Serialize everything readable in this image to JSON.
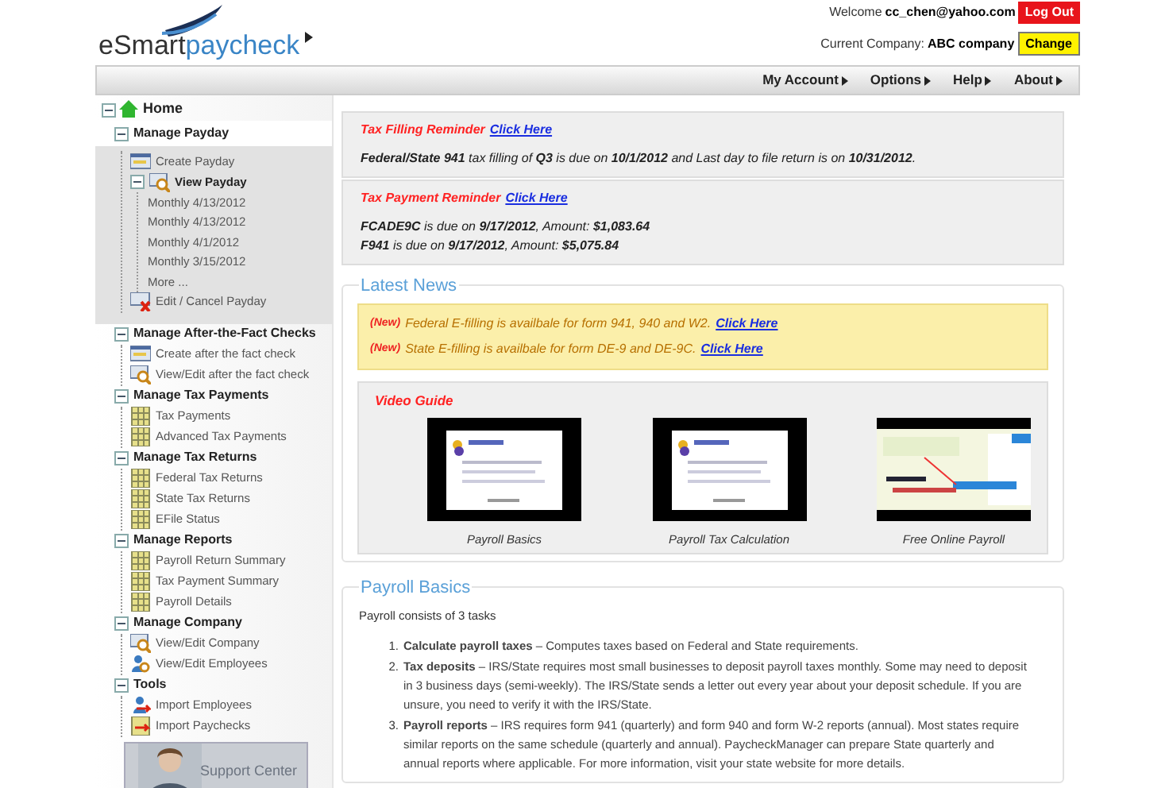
{
  "header": {
    "logo_left": "eSmart",
    "logo_right": "paycheck",
    "welcome_label": "Welcome",
    "user_email": "cc_chen@yahoo.com",
    "logout_button": "Log Out",
    "company_label": "Current Company:",
    "company_name": "ABC company",
    "change_button": "Change"
  },
  "nav_menu": [
    {
      "label": "My Account"
    },
    {
      "label": "Options"
    },
    {
      "label": "Help"
    },
    {
      "label": "About"
    }
  ],
  "sidebar": {
    "items": [
      {
        "label": "Home",
        "kind": "home",
        "expanded": true,
        "children": [
          {
            "label": "Manage Payday",
            "expanded": true,
            "selected": true,
            "children": [
              {
                "label": "Create Payday",
                "kind": "form"
              },
              {
                "label": "View Payday",
                "kind": "search",
                "expanded": true,
                "children": [
                  {
                    "label": "Monthly 4/13/2012"
                  },
                  {
                    "label": "Monthly 4/13/2012"
                  },
                  {
                    "label": "Monthly 4/1/2012"
                  },
                  {
                    "label": "Monthly 3/15/2012"
                  },
                  {
                    "label": "More ..."
                  }
                ]
              },
              {
                "label": "Edit / Cancel Payday",
                "kind": "cancel"
              }
            ]
          },
          {
            "label": "Manage After-the-Fact Checks",
            "expanded": true,
            "selected": false,
            "children": [
              {
                "label": "Create after the fact check",
                "kind": "form"
              },
              {
                "label": "View/Edit after the fact check",
                "kind": "search"
              }
            ]
          },
          {
            "label": "Manage Tax Payments",
            "expanded": true,
            "selected": false,
            "children": [
              {
                "label": "Tax Payments",
                "kind": "grid"
              },
              {
                "label": "Advanced Tax Payments",
                "kind": "grid"
              }
            ]
          },
          {
            "label": "Manage Tax Returns",
            "expanded": true,
            "selected": false,
            "children": [
              {
                "label": "Federal Tax Returns",
                "kind": "grid"
              },
              {
                "label": "State Tax Returns",
                "kind": "grid"
              },
              {
                "label": "EFile Status",
                "kind": "grid"
              }
            ]
          },
          {
            "label": "Manage Reports",
            "expanded": true,
            "selected": false,
            "children": [
              {
                "label": "Payroll Return Summary",
                "kind": "grid"
              },
              {
                "label": "Tax Payment Summary",
                "kind": "grid"
              },
              {
                "label": "Payroll Details",
                "kind": "grid"
              }
            ]
          },
          {
            "label": "Manage Company",
            "expanded": true,
            "selected": false,
            "children": [
              {
                "label": "View/Edit Company",
                "kind": "search"
              },
              {
                "label": "View/Edit Employees",
                "kind": "person-search"
              }
            ]
          },
          {
            "label": "Tools",
            "expanded": true,
            "selected": false,
            "children": [
              {
                "label": "Import Employees",
                "kind": "person-import"
              },
              {
                "label": "Import Paychecks",
                "kind": "import"
              }
            ]
          }
        ]
      }
    ],
    "support_banner": {
      "label": "Support Center"
    }
  },
  "reminders": [
    {
      "title": "Tax Filling Reminder",
      "link": "Click Here",
      "lines": [
        "**Federal/State 941** tax filling of **Q3** is due on **10/1/2012** and Last day to file return is on **10/31/2012**."
      ]
    },
    {
      "title": "Tax Payment Reminder",
      "link": "Click Here",
      "lines": [
        "**FCADE9C** is due on **9/17/2012**, Amount: **$1,083.64**",
        "**F941** is due on **9/17/2012**, Amount: **$5,075.84**"
      ]
    }
  ],
  "latest_news": {
    "title": "Latest News",
    "items": [
      {
        "badge": "(New)",
        "text": "Federal E-filling is availbale for form 941, 940 and W2.",
        "link": "Click Here"
      },
      {
        "badge": "(New)",
        "text": "State E-filling is availbale for form DE-9 and DE-9C.",
        "link": "Click Here"
      }
    ],
    "video_guide": {
      "title": "Video Guide",
      "videos": [
        {
          "caption": "Payroll Basics",
          "kind": "slide"
        },
        {
          "caption": "Payroll Tax Calculation",
          "kind": "slide"
        },
        {
          "caption": "Free Online Payroll",
          "kind": "screen"
        }
      ]
    }
  },
  "payroll_basics": {
    "title": "Payroll Basics",
    "intro": "Payroll consists of 3 tasks",
    "tasks": [
      {
        "number": "1.",
        "text": "**Calculate payroll taxes** – Computes taxes based on Federal and State requirements."
      },
      {
        "number": "2.",
        "text": "**Tax deposits** – IRS/State requires most small businesses to deposit payroll taxes monthly. Some may need to deposit in 3 business days (semi-weekly). The IRS/State sends a letter out every year about your deposit schedule. If you are unsure, you need to verify it with the IRS/State."
      },
      {
        "number": "3.",
        "text": "**Payroll reports** – IRS requires form 941 (quarterly) and form 940 and form W-2 reports (annual). Most states require similar reports on the same schedule (quarterly and annual). PaycheckManager can prepare State quarterly and annual reports where applicable. For more information, visit your state website for more details."
      }
    ]
  }
}
